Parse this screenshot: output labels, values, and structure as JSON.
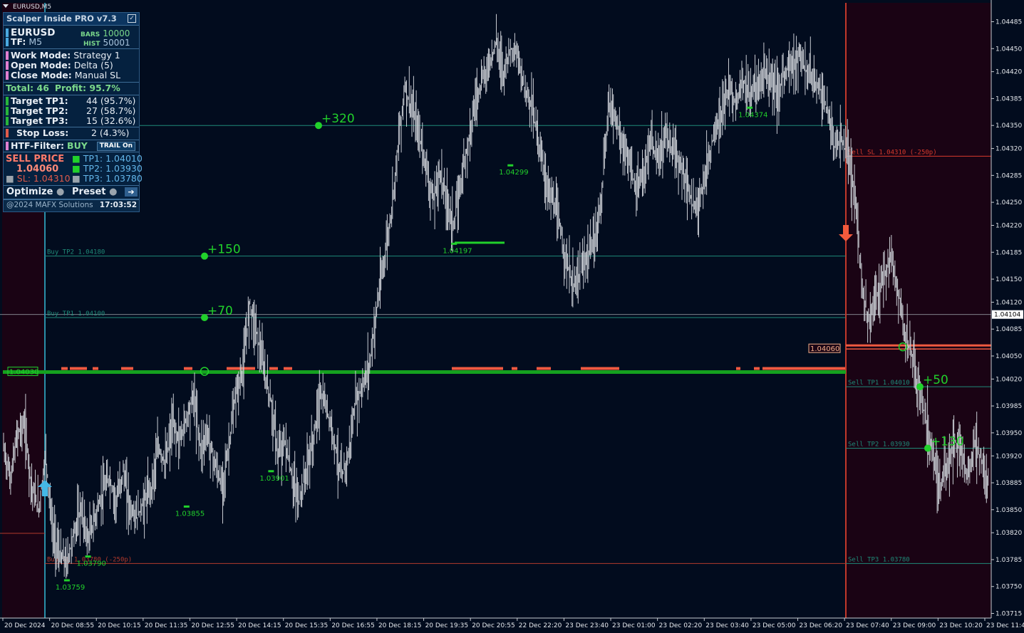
{
  "window_title": "EURUSD,M5",
  "panel": {
    "title": "Scalper Inside PRO v7.3",
    "symbol": "EURUSD",
    "bars_label": "BARS",
    "bars_value": "10000",
    "tf_label": "TF:",
    "tf_value": "M5",
    "hist_label": "HIST",
    "hist_value": "50001",
    "work_mode_label": "Work  Mode:",
    "work_mode_value": "Strategy 1",
    "open_mode_label": "Open  Mode:",
    "open_mode_value": "Delta (5)",
    "close_mode_label": "Close Mode:",
    "close_mode_value": "Manual SL",
    "total_label": "Total: 46",
    "profit_label": "Profit: 95.7%",
    "tp1_label": "Target TP1:",
    "tp1_value": "44 (95.7%)",
    "tp2_label": "Target TP2:",
    "tp2_value": "27 (58.7%)",
    "tp3_label": "Target TP3:",
    "tp3_value": "15 (32.6%)",
    "sl_label": "Stop Loss:",
    "sl_value": "2 (4.3%)",
    "htf_label": "HTF-Filter:",
    "htf_value": "BUY",
    "trail_label": "TRAIL On",
    "sell_price_label": "SELL PRICE",
    "sell_price_value": "1.04060",
    "sl_price": "SL: 1.04310",
    "tp1_price": "TP1: 1.04010",
    "tp2_price": "TP2: 1.03930",
    "tp3_price": "TP3: 1.03780",
    "optimize_label": "Optimize",
    "preset_label": "Preset",
    "copyright": "@2024 MAFX Solutions",
    "clock": "17:03:52"
  },
  "colors": {
    "background": "#020c1e",
    "sell_zone": "#1a0314",
    "candle": "#c8ccd2",
    "level_line": "#1f8a78",
    "accent_green": "#21d12b",
    "sell_red": "#d93a2c",
    "mid_orange": "#f05a40",
    "arrow_up": "#45b8e6",
    "arrow_down": "#f25a3c"
  },
  "chart_data": {
    "type": "ohlc",
    "symbol": "EURUSD",
    "timeframe": "M5",
    "ylim": [
      1.0373,
      1.045
    ],
    "yticks": [
      "1.04485",
      "1.04450",
      "1.04420",
      "1.04385",
      "1.04350",
      "1.04320",
      "1.04285",
      "1.04250",
      "1.04220",
      "1.04185",
      "1.04150",
      "1.04120",
      "1.04085",
      "1.04050",
      "1.04020",
      "1.03985",
      "1.03950",
      "1.03920",
      "1.03885",
      "1.03850",
      "1.03820",
      "1.03785",
      "1.03750",
      "1.03715"
    ],
    "xticks": [
      "20 Dec 2024",
      "20 Dec 08:55",
      "20 Dec 10:15",
      "20 Dec 11:35",
      "20 Dec 12:55",
      "20 Dec 14:15",
      "20 Dec 15:35",
      "20 Dec 16:55",
      "20 Dec 18:15",
      "20 Dec 19:35",
      "20 Dec 20:55",
      "22 Dec 22:20",
      "23 Dec 23:40",
      "23 Dec 01:00",
      "23 Dec 02:20",
      "23 Dec 03:40",
      "23 Dec 05:00",
      "23 Dec 06:20",
      "23 Dec 07:40",
      "23 Dec 09:00",
      "23 Dec 10:20",
      "23 Dec 11:40"
    ],
    "current_price": "1.04104",
    "mid_line_price": "1.04030",
    "sell_entry_box": "1.04060",
    "price_path": [
      1.0393,
      1.0389,
      1.0395,
      1.0396,
      1.0388,
      1.0385,
      1.0392,
      1.0382,
      1.0379,
      1.0378,
      1.0382,
      1.0385,
      1.0381,
      1.0384,
      1.0387,
      1.0389,
      1.0386,
      1.039,
      1.0385,
      1.0384,
      1.0386,
      1.0388,
      1.0393,
      1.0391,
      1.0396,
      1.0394,
      1.0397,
      1.04,
      1.0393,
      1.0395,
      1.0391,
      1.0388,
      1.0393,
      1.04,
      1.0403,
      1.0412,
      1.0408,
      1.0403,
      1.0399,
      1.0392,
      1.0394,
      1.0389,
      1.0386,
      1.039,
      1.0394,
      1.04,
      1.0398,
      1.0394,
      1.0389,
      1.0392,
      1.0399,
      1.0401,
      1.0404,
      1.0411,
      1.0417,
      1.0423,
      1.0432,
      1.044,
      1.0437,
      1.0434,
      1.043,
      1.0425,
      1.0429,
      1.0425,
      1.0422,
      1.0428,
      1.0433,
      1.0438,
      1.0441,
      1.0443,
      1.0446,
      1.0442,
      1.0445,
      1.0444,
      1.044,
      1.0438,
      1.0433,
      1.0428,
      1.0425,
      1.0422,
      1.0417,
      1.0414,
      1.0416,
      1.0418,
      1.042,
      1.0426,
      1.0438,
      1.0436,
      1.0432,
      1.043,
      1.0426,
      1.0429,
      1.0433,
      1.043,
      1.0434,
      1.0432,
      1.043,
      1.0428,
      1.0424,
      1.0426,
      1.043,
      1.0434,
      1.0436,
      1.044,
      1.0438,
      1.0441,
      1.0439,
      1.044,
      1.0442,
      1.0441,
      1.0439,
      1.0442,
      1.0443,
      1.0444,
      1.0442,
      1.0441,
      1.044,
      1.0437,
      1.0432,
      1.0433,
      1.0431,
      1.0425,
      1.0414,
      1.0409,
      1.0413,
      1.0415,
      1.0418,
      1.0414,
      1.0408,
      1.0405,
      1.0401,
      1.0397,
      1.0393,
      1.0388,
      1.039,
      1.0394,
      1.0393,
      1.0389,
      1.0394,
      1.0391,
      1.0388
    ],
    "swing_labels": [
      {
        "text": "1.03759",
        "x_index": 9,
        "price": 1.03759
      },
      {
        "text": "1.03790",
        "x_index": 12,
        "price": 1.0379
      },
      {
        "text": "1.03855",
        "x_index": 26,
        "price": 1.03855
      },
      {
        "text": "1.03901",
        "x_index": 38,
        "price": 1.03901
      },
      {
        "text": "1.04197",
        "x_index": 64,
        "price": 1.04197
      },
      {
        "text": "1.04299",
        "x_index": 72,
        "price": 1.04299
      },
      {
        "text": "1.04374",
        "x_index": 106,
        "price": 1.04374
      }
    ],
    "buy_levels": [
      {
        "label": "Buy TP2 1.04180",
        "price": 1.0418
      },
      {
        "label": "Buy TP1 1.04100",
        "price": 1.041
      },
      {
        "label": "Buy SL 1.03780 (-250p)",
        "price": 1.0378
      }
    ],
    "sell_levels": [
      {
        "label": "Sell SL 1.04310 (-250p)",
        "price": 1.0431
      },
      {
        "label": "Sell TP1 1.04010",
        "price": 1.0401
      },
      {
        "label": "Sell TP2 1.03930",
        "price": 1.0393
      },
      {
        "label": "Sell TP3 1.03780",
        "price": 1.0378
      }
    ],
    "profit_marks": [
      {
        "text": "+320",
        "price": 1.0435
      },
      {
        "text": "+150",
        "price": 1.0418
      },
      {
        "text": "+70",
        "price": 1.041
      },
      {
        "text": "+50",
        "price": 1.0401
      },
      {
        "text": "+130",
        "price": 1.0393
      }
    ]
  }
}
